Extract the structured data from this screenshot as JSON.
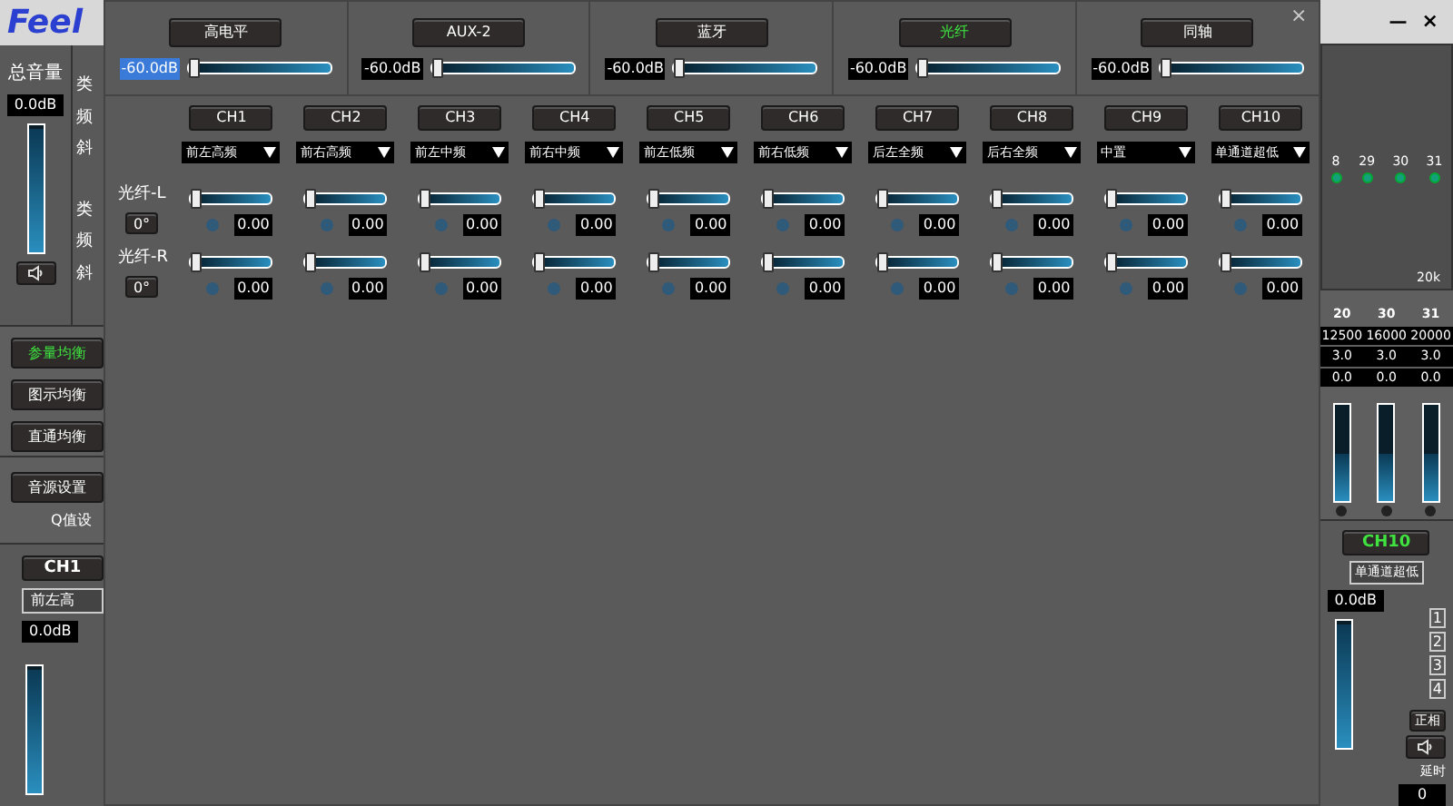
{
  "app": {
    "logo": "Feel",
    "window_controls": [
      "—",
      "×"
    ],
    "master": {
      "label": "总音量",
      "reading": "0.0dB",
      "level": 0.97
    },
    "eq_labels": [
      "类",
      "频",
      "斜",
      "类",
      "频",
      "斜"
    ],
    "modes": [
      {
        "label": "参量均衡",
        "selected": true
      },
      {
        "label": "图示均衡",
        "selected": false
      },
      {
        "label": "直通均衡",
        "selected": false
      }
    ],
    "source_button": "音源设置",
    "q_label": "Q值设",
    "left_channel": {
      "name": "CH1",
      "output": "前左高",
      "reading": "0.0dB",
      "level": 0.97
    },
    "chart_bands": [
      "8",
      "29",
      "30",
      "31"
    ],
    "chart_end": "20k",
    "bands": [
      {
        "number": "20",
        "freq": "12500",
        "q": "3.0",
        "gain": "0.0",
        "level": 0.5
      },
      {
        "number": "30",
        "freq": "16000",
        "q": "3.0",
        "gain": "0.0",
        "level": 0.5
      },
      {
        "number": "31",
        "freq": "20000",
        "q": "3.0",
        "gain": "0.0",
        "level": 0.5
      }
    ],
    "right_channel": {
      "name": "CH10",
      "output": "单通道超低",
      "reading": "0.0dB",
      "level": 0.97,
      "groups": [
        "1",
        "2",
        "3",
        "4"
      ],
      "phase": "正相",
      "delay_label": "延时",
      "delay": "0"
    }
  },
  "dialog": {
    "close": "×",
    "sources": [
      {
        "label": "高电平",
        "selected": false,
        "reading": "-60.0dB",
        "reading_highlighted": true,
        "level": 0
      },
      {
        "label": "AUX-2",
        "selected": false,
        "reading": "-60.0dB",
        "reading_highlighted": false,
        "level": 0
      },
      {
        "label": "蓝牙",
        "selected": false,
        "reading": "-60.0dB",
        "reading_highlighted": false,
        "level": 0
      },
      {
        "label": "光纤",
        "selected": true,
        "reading": "-60.0dB",
        "reading_highlighted": false,
        "level": 0
      },
      {
        "label": "同轴",
        "selected": false,
        "reading": "-60.0dB",
        "reading_highlighted": false,
        "level": 0
      }
    ],
    "channels": [
      {
        "name": "CH1",
        "output": "前左高频"
      },
      {
        "name": "CH2",
        "output": "前右高频"
      },
      {
        "name": "CH3",
        "output": "前左中频"
      },
      {
        "name": "CH4",
        "output": "前右中频"
      },
      {
        "name": "CH5",
        "output": "前左低频"
      },
      {
        "name": "CH6",
        "output": "前右低频"
      },
      {
        "name": "CH7",
        "output": "后左全频"
      },
      {
        "name": "CH8",
        "output": "后右全频"
      },
      {
        "name": "CH9",
        "output": "中置"
      },
      {
        "name": "CH10",
        "output": "单通道超低"
      }
    ],
    "inputs": [
      {
        "label": "光纤-L",
        "phase": "0°",
        "mix": [
          {
            "level": 0,
            "value": "0.00"
          },
          {
            "level": 0,
            "value": "0.00"
          },
          {
            "level": 0,
            "value": "0.00"
          },
          {
            "level": 0,
            "value": "0.00"
          },
          {
            "level": 0,
            "value": "0.00"
          },
          {
            "level": 0,
            "value": "0.00"
          },
          {
            "level": 0,
            "value": "0.00"
          },
          {
            "level": 0,
            "value": "0.00"
          },
          {
            "level": 0,
            "value": "0.00"
          },
          {
            "level": 0,
            "value": "0.00"
          }
        ]
      },
      {
        "label": "光纤-R",
        "phase": "0°",
        "mix": [
          {
            "level": 0,
            "value": "0.00"
          },
          {
            "level": 0,
            "value": "0.00"
          },
          {
            "level": 0,
            "value": "0.00"
          },
          {
            "level": 0,
            "value": "0.00"
          },
          {
            "level": 0,
            "value": "0.00"
          },
          {
            "level": 0,
            "value": "0.00"
          },
          {
            "level": 0,
            "value": "0.00"
          },
          {
            "level": 0,
            "value": "0.00"
          },
          {
            "level": 0,
            "value": "0.00"
          },
          {
            "level": 0,
            "value": "0.00"
          }
        ]
      }
    ]
  }
}
